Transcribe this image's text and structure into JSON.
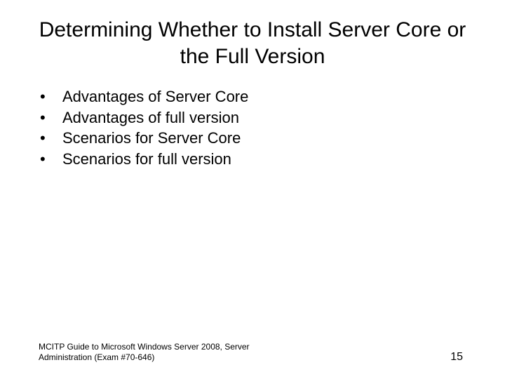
{
  "title": "Determining Whether to Install Server Core or the Full Version",
  "bullets": [
    "Advantages of Server Core",
    "Advantages of full version",
    "Scenarios for Server Core",
    "Scenarios for full version"
  ],
  "footer": {
    "text": "MCITP Guide to Microsoft Windows Server 2008, Server Administration (Exam #70-646)",
    "page": "15"
  }
}
